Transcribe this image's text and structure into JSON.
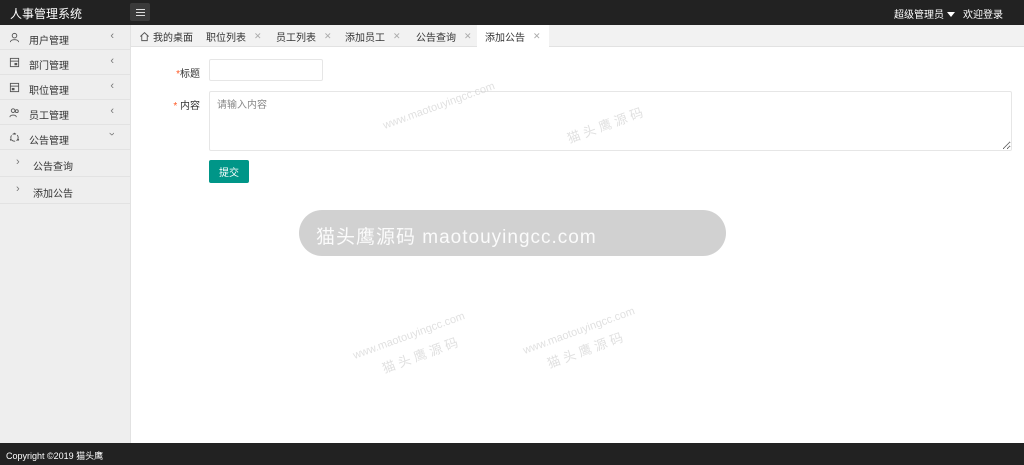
{
  "header": {
    "logo": "人事管理系统",
    "user_label": "超级管理员",
    "welcome_label": "欢迎登录"
  },
  "sidebar": {
    "items": [
      {
        "label": "用户管理",
        "icon": "user-icon"
      },
      {
        "label": "部门管理",
        "icon": "department-icon"
      },
      {
        "label": "职位管理",
        "icon": "position-icon"
      },
      {
        "label": "员工管理",
        "icon": "staff-icon"
      },
      {
        "label": "公告管理",
        "icon": "announcement-icon"
      }
    ],
    "sub_items": [
      {
        "label": "公告查询"
      },
      {
        "label": "添加公告"
      }
    ]
  },
  "tabs": [
    {
      "label": "我的桌面",
      "icon": "home-icon"
    },
    {
      "label": "职位列表"
    },
    {
      "label": "员工列表"
    },
    {
      "label": "添加员工"
    },
    {
      "label": "公告查询"
    },
    {
      "label": "添加公告",
      "active": true
    }
  ],
  "form": {
    "title_label": "标题",
    "title_value": "",
    "content_label": "内容",
    "content_placeholder": "请输入内容",
    "required_mark": "*",
    "submit_label": "提交"
  },
  "watermark": {
    "banner_text": "猫头鹰源码 maotouyingcc.com",
    "tile_text": "猫 头 鹰 源 码",
    "tile_url": "www.maotouyingcc.com"
  },
  "footer": {
    "copyright": "Copyright ©2019 猫头鹰"
  },
  "colors": {
    "topbar_bg": "#222222",
    "sidebar_bg": "#eeeeee",
    "tabbar_bg": "#f2f2f2",
    "primary_button": "#009688",
    "required": "#ff5722"
  }
}
